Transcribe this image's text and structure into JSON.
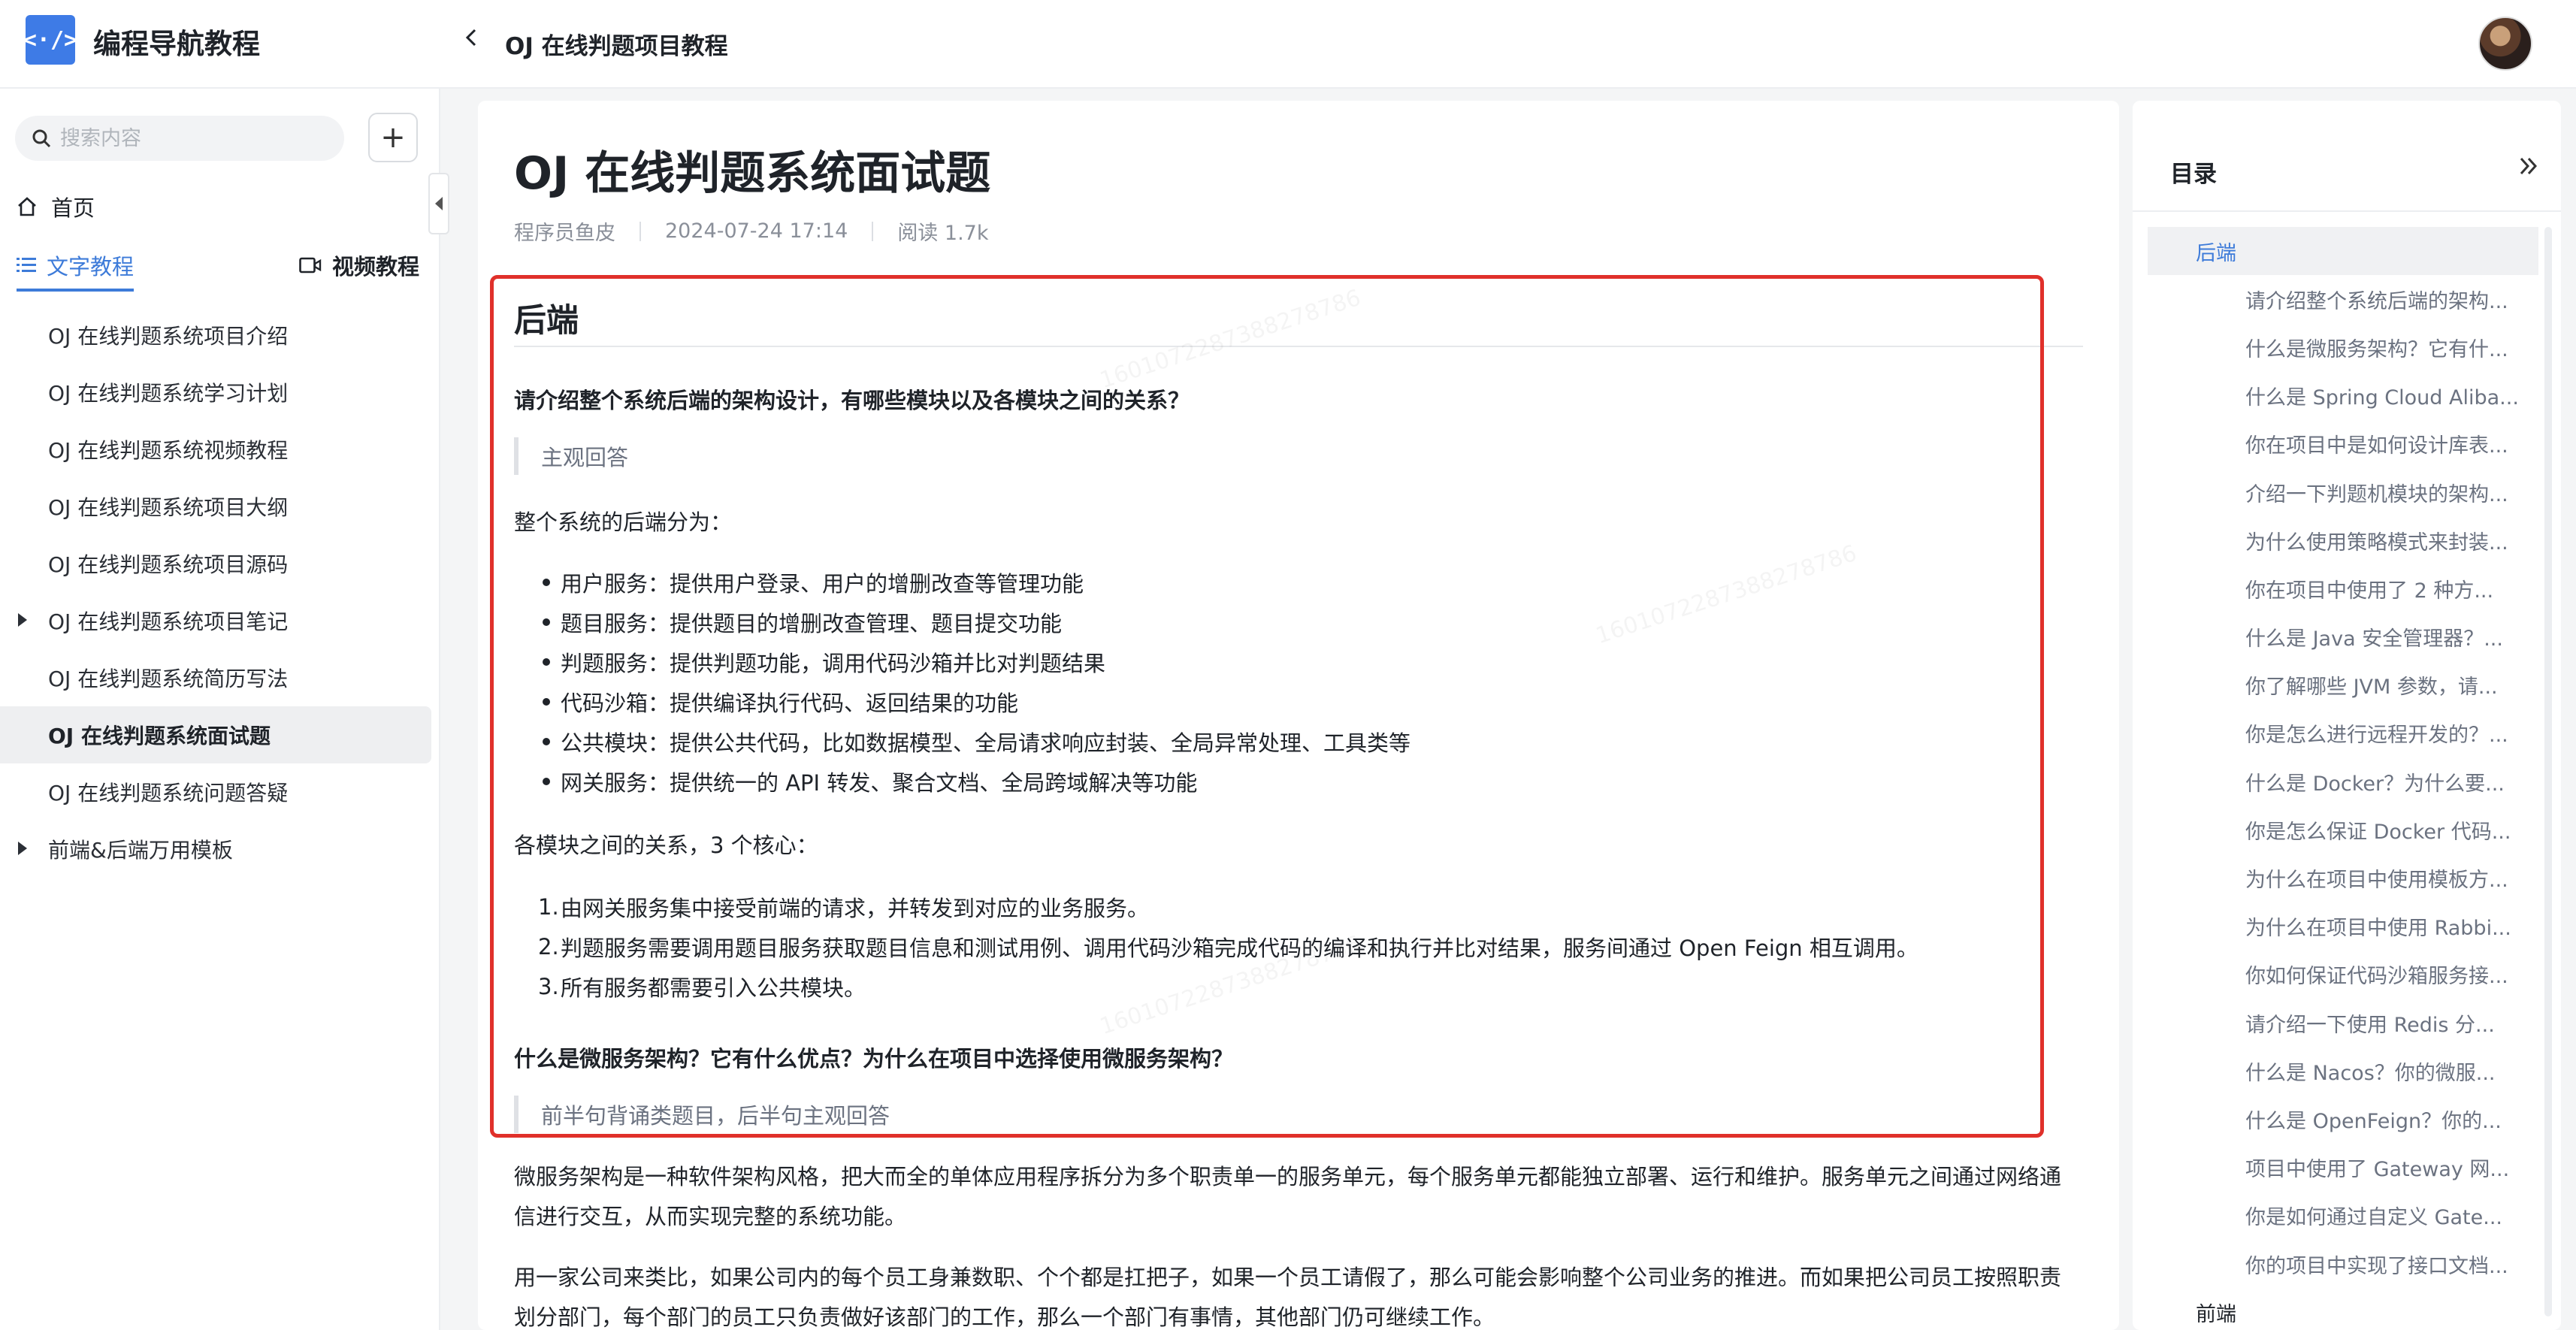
{
  "header": {
    "brand": "编程导航教程",
    "logo_glyph": "<·/>",
    "title": "OJ 在线判题项目教程"
  },
  "sidebar": {
    "search_placeholder": "搜索内容",
    "add_label": "+",
    "home_label": "首页",
    "tab_text": "文字教程",
    "tab_video": "视频教程",
    "items": [
      {
        "label": "OJ 在线判题系统项目介绍"
      },
      {
        "label": "OJ 在线判题系统学习计划"
      },
      {
        "label": "OJ 在线判题系统视频教程"
      },
      {
        "label": "OJ 在线判题系统项目大纲"
      },
      {
        "label": "OJ 在线判题系统项目源码"
      },
      {
        "label": "OJ 在线判题系统项目笔记"
      },
      {
        "label": "OJ 在线判题系统简历写法"
      },
      {
        "label": "OJ 在线判题系统面试题"
      },
      {
        "label": "OJ 在线判题系统问题答疑"
      },
      {
        "label": "前端&后端万用模板"
      }
    ]
  },
  "article": {
    "title": "OJ 在线判题系统面试题",
    "author": "程序员鱼皮",
    "date": "2024-07-24 17:14",
    "reads": "阅读 1.7k",
    "section": "后端",
    "q1": "请介绍整个系统后端的架构设计，有哪些模块以及各模块之间的关系？",
    "q1_note": "主观回答",
    "intro": "整个系统的后端分为：",
    "services": [
      "用户服务：提供用户登录、用户的增删改查等管理功能",
      "题目服务：提供题目的增删改查管理、题目提交功能",
      "判题服务：提供判题功能，调用代码沙箱并比对判题结果",
      "代码沙箱：提供编译执行代码、返回结果的功能",
      "公共模块：提供公共代码，比如数据模型、全局请求响应封装、全局异常处理、工具类等",
      "网关服务：提供统一的 API 转发、聚合文档、全局跨域解决等功能"
    ],
    "relation_intro": "各模块之间的关系，3 个核心：",
    "relations": [
      "由网关服务集中接受前端的请求，并转发到对应的业务服务。",
      "判题服务需要调用题目服务获取题目信息和测试用例、调用代码沙箱完成代码的编译和执行并比对结果，服务间通过 Open Feign 相互调用。",
      "所有服务都需要引入公共模块。"
    ],
    "q2": "什么是微服务架构？它有什么优点？为什么在项目中选择使用微服务架构？",
    "q2_note": "前半句背诵类题目，后半句主观回答",
    "para1": "微服务架构是一种软件架构风格，把大而全的单体应用程序拆分为多个职责单一的服务单元，每个服务单元都能独立部署、运行和维护。服务单元之间通过网络通信进行交互，从而实现完整的系统功能。",
    "para2": "用一家公司来类比，如果公司内的每个员工身兼数职、个个都是扛把子，如果一个员工请假了，那么可能会影响整个公司业务的推进。而如果把公司员工按照职责划分部门，每个部门的员工只负责做好该部门的工作，那么一个部门有事情，其他部门仍可继续工作。"
  },
  "toc": {
    "title": "目录",
    "items": [
      {
        "label": "后端",
        "level": 1,
        "active": true
      },
      {
        "label": "请介绍整个系统后端的架构...",
        "level": 2
      },
      {
        "label": "什么是微服务架构？它有什...",
        "level": 2
      },
      {
        "label": "什么是 Spring Cloud Aliba...",
        "level": 2
      },
      {
        "label": "你在项目中是如何设计库表...",
        "level": 2
      },
      {
        "label": "介绍一下判题机模块的架构...",
        "level": 2
      },
      {
        "label": "为什么使用策略模式来封装...",
        "level": 2
      },
      {
        "label": "你在项目中使用了 2 种方...",
        "level": 2
      },
      {
        "label": "什么是 Java 安全管理器？...",
        "level": 2
      },
      {
        "label": "你了解哪些 JVM 参数，请...",
        "level": 2
      },
      {
        "label": "你是怎么进行远程开发的？...",
        "level": 2
      },
      {
        "label": "什么是 Docker？为什么要...",
        "level": 2
      },
      {
        "label": "你是怎么保证 Docker 代码...",
        "level": 2
      },
      {
        "label": "为什么在项目中使用模板方...",
        "level": 2
      },
      {
        "label": "为什么在项目中使用 Rabbi...",
        "level": 2
      },
      {
        "label": "你如何保证代码沙箱服务接...",
        "level": 2
      },
      {
        "label": "请介绍一下使用 Redis 分...",
        "level": 2
      },
      {
        "label": "什么是 Nacos？你的微服...",
        "level": 2
      },
      {
        "label": "什么是 OpenFeign？你的...",
        "level": 2
      },
      {
        "label": "项目中使用了 Gateway 网...",
        "level": 2
      },
      {
        "label": "你是如何通过自定义 Gate...",
        "level": 2
      },
      {
        "label": "你的项目中实现了接口文档...",
        "level": 2
      },
      {
        "label": "前端",
        "level": 1
      }
    ]
  },
  "watermark": "16010722873882787​86",
  "colors": {
    "accent": "#3d7bd9",
    "highlight_border": "#e0302a",
    "logo": "#3e7be6"
  }
}
